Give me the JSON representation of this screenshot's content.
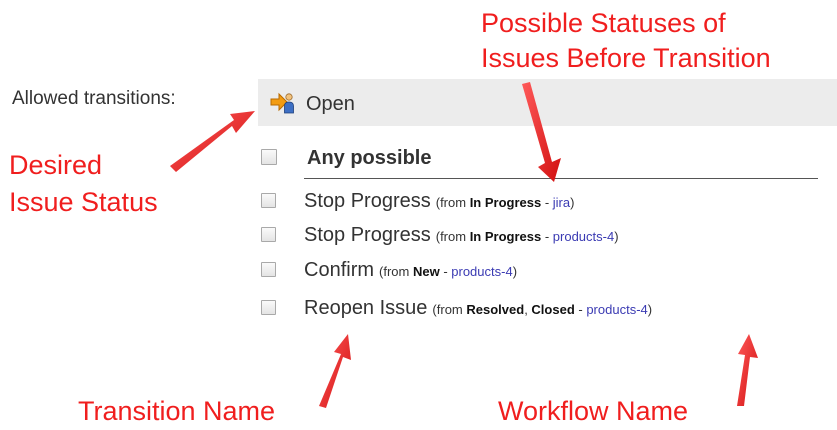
{
  "field_label": "Allowed transitions:",
  "destination": {
    "icon": "transition-arrow-icon",
    "label": "Open"
  },
  "select_all": {
    "label": "Any possible"
  },
  "transitions": [
    {
      "name": "Stop Progress",
      "from_prefix": "(from ",
      "statuses": [
        {
          "label": "In Progress",
          "sep": ""
        }
      ],
      "dash": " - ",
      "workflow": "jira",
      "close": ")"
    },
    {
      "name": "Stop Progress",
      "from_prefix": "(from ",
      "statuses": [
        {
          "label": "In Progress",
          "sep": ""
        }
      ],
      "dash": " - ",
      "workflow": "products-4",
      "close": ")"
    },
    {
      "name": "Confirm",
      "from_prefix": "(from ",
      "statuses": [
        {
          "label": "New",
          "sep": ""
        }
      ],
      "dash": " - ",
      "workflow": "products-4",
      "close": ")"
    },
    {
      "name": "Reopen Issue",
      "from_prefix": "(from ",
      "statuses": [
        {
          "label": "Resolved",
          "sep": ", "
        },
        {
          "label": "Closed",
          "sep": ""
        }
      ],
      "dash": " - ",
      "workflow": "products-4",
      "close": ")"
    }
  ],
  "annotations": {
    "possible_statuses_line1": "Possible Statuses of",
    "possible_statuses_line2": "Issues Before Transition",
    "desired_status_line1": "Desired",
    "desired_status_line2": "Issue Status",
    "transition_name": "Transition Name",
    "workflow_name": "Workflow Name"
  },
  "colors": {
    "annotation": "#f01e1e",
    "workflow_link": "#3b3bb3",
    "status_bar": "#ececec"
  }
}
